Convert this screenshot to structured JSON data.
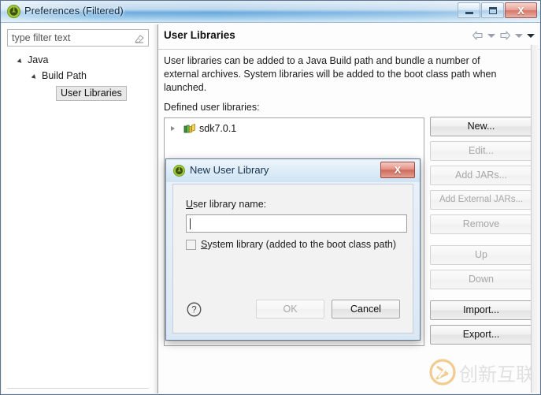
{
  "window": {
    "title": "Preferences (Filtered)",
    "app_icon": "eclipse-icon",
    "controls": {
      "minimize_label": "Minimize",
      "maximize_label": "Maximize",
      "close_label": "X"
    }
  },
  "sidebar": {
    "filter": {
      "placeholder": "type filter text",
      "value": "type filter text",
      "clear_icon": "eraser-icon"
    },
    "tree": [
      {
        "label": "Java",
        "level": 0,
        "expanded": true,
        "selected": false
      },
      {
        "label": "Build Path",
        "level": 1,
        "expanded": true,
        "selected": false
      },
      {
        "label": "User Libraries",
        "level": 2,
        "expanded": false,
        "selected": true
      }
    ]
  },
  "page": {
    "title": "User Libraries",
    "nav": {
      "back_icon": "back-arrow-icon",
      "back_menu_icon": "chevron-down-icon",
      "forward_icon": "forward-arrow-icon",
      "forward_menu_icon": "chevron-down-icon",
      "view_menu_icon": "chevron-down-icon"
    },
    "description": "User libraries can be added to a Java Build path and bundle a number of external archives. System libraries will be added to the boot class path when launched.",
    "defined_label": "Defined user libraries:",
    "libraries": [
      {
        "name": "sdk7.0.1",
        "icon": "library-icon",
        "expanded": false
      }
    ],
    "buttons": [
      {
        "label": "New...",
        "enabled": true,
        "gap_before": false
      },
      {
        "label": "Edit...",
        "enabled": false,
        "gap_before": false
      },
      {
        "label": "Add JARs...",
        "enabled": false,
        "gap_before": false
      },
      {
        "label": "Add External JARs...",
        "enabled": false,
        "gap_before": false
      },
      {
        "label": "Remove",
        "enabled": false,
        "gap_before": false
      },
      {
        "label": "Up",
        "enabled": false,
        "gap_before": true
      },
      {
        "label": "Down",
        "enabled": false,
        "gap_before": false
      },
      {
        "label": "Import...",
        "enabled": true,
        "gap_before": true
      },
      {
        "label": "Export...",
        "enabled": true,
        "gap_before": false
      }
    ]
  },
  "dialog": {
    "title": "New User Library",
    "icon": "eclipse-icon",
    "close_label": "X",
    "name_label_mnemonic": "U",
    "name_label_rest": "ser library name:",
    "name_value": "",
    "name_placeholder": "",
    "checkbox": {
      "mnemonic": "S",
      "rest": "ystem library (added to the boot class path)",
      "checked": false
    },
    "help_icon": "help-icon",
    "ok_label": "OK",
    "ok_enabled": false,
    "cancel_label": "Cancel",
    "cancel_enabled": true
  },
  "watermark": {
    "text": "创新互联",
    "logo_icon": "brand-logo-icon"
  },
  "colors": {
    "title_blue": "#6aa8dc",
    "close_red": "#cf6a5b",
    "accent_green": "#8cbf3f",
    "watermark_gray": "#c9c9c9",
    "brand_orange": "#f0a81e"
  }
}
